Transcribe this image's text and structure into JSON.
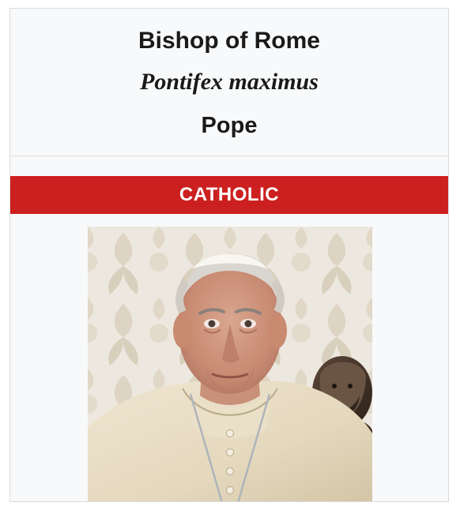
{
  "infobox": {
    "title": "Bishop of Rome",
    "latin_title": "Pontifex maximus",
    "short_title": "Pope",
    "banner_label": "CATHOLIC",
    "colors": {
      "banner": "#cc2020",
      "background": "#f8f9fa",
      "text": "#1a1a1a"
    },
    "portrait": {
      "icon": "portrait-photo"
    }
  }
}
